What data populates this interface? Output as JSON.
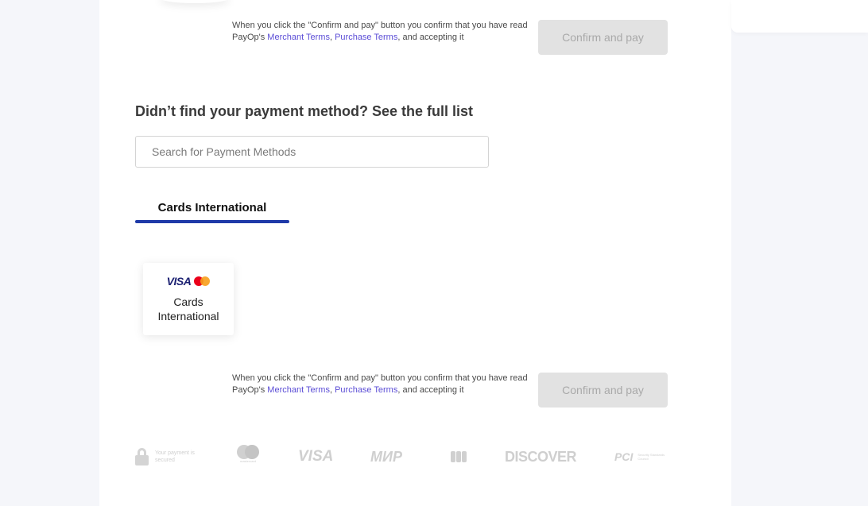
{
  "terms": {
    "prefix": "When you click the \"Confirm and pay\" button you confirm that you have read PayOp's ",
    "merchant_terms_link": "Merchant Terms",
    "separator": ", ",
    "purchase_terms_link": "Purchase Terms",
    "suffix": ", and accepting it"
  },
  "confirm_button_label": "Confirm and pay",
  "payment_methods": {
    "heading": "Didn’t find your payment method? See the full list",
    "search_placeholder": "Search for Payment Methods",
    "active_tab": "Cards International",
    "cards": [
      {
        "name": "Cards International",
        "logo_text": "VISA"
      }
    ]
  },
  "footer": {
    "secure_text": "Your payment is secured",
    "mastercard_text": "mastercard",
    "visa_text": "VISA",
    "mir_text": "МИР",
    "discover_text": "DISCOVER",
    "pci_text": "PCI",
    "pci_sub_text": "Security Standards Council"
  },
  "colors": {
    "link": "#5b4dd6",
    "tab_underline": "#1f3aa8",
    "button_disabled_bg": "#e2e2e2",
    "button_disabled_text": "#a9a9a9"
  },
  "icons": [
    "lock-icon",
    "visa-icon",
    "mastercard-icon",
    "mir-icon",
    "jcb-icon",
    "discover-icon",
    "pci-icon"
  ]
}
